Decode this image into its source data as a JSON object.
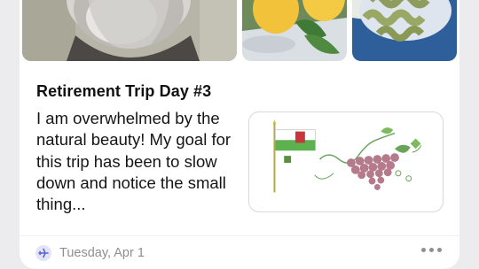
{
  "entry": {
    "title": "Retirement Trip Day #3",
    "body": "I am overwhelmed by the natural beauty! My goal for this trip has been to slow down and notice the small thing...",
    "date": "Tuesday, Apr 1"
  },
  "photos": [
    "bearded-man-photo",
    "lemons-photo",
    "pasta-photo"
  ],
  "sticker": "flag-and-grapes-sticker",
  "icons": {
    "footer": "airplane-icon",
    "menu": "more-icon"
  },
  "colors": {
    "background": "#ecebee",
    "card": "#ffffff",
    "muted": "#8e8e93",
    "accent": "#5b63d6"
  }
}
